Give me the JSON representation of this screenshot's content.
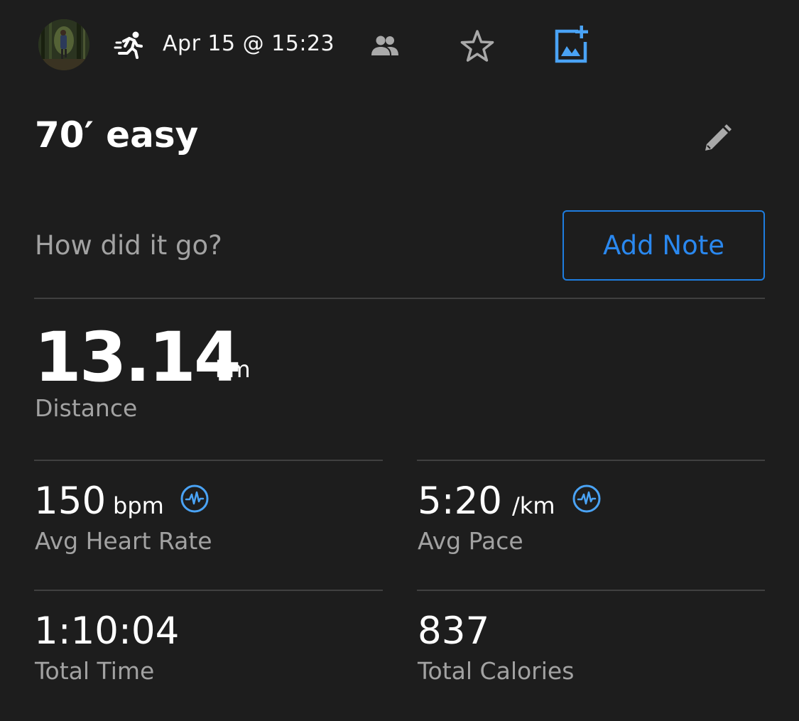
{
  "header": {
    "date_time": "Apr 15 @ 15:23",
    "icons": [
      "avatar",
      "running-icon",
      "people-icon",
      "star-icon",
      "add-photo-icon"
    ]
  },
  "activity": {
    "title": "70′ easy"
  },
  "note": {
    "prompt": "How did it go?",
    "button_label": "Add Note"
  },
  "stats": {
    "distance": {
      "value": "13.14",
      "unit": "km",
      "label": "Distance"
    },
    "heart_rate": {
      "value": "150",
      "unit": "bpm",
      "label": "Avg Heart Rate"
    },
    "pace": {
      "value": "5:20",
      "unit": "/km",
      "label": "Avg Pace"
    },
    "total_time": {
      "value": "1:10:04",
      "label": "Total Time"
    },
    "calories": {
      "value": "837",
      "label": "Total Calories"
    }
  },
  "colors": {
    "background": "#1d1d1d",
    "accent": "#2a88ef",
    "icon_blue": "#4aa3f5",
    "secondary_text": "#a2a2a2",
    "divider": "#404040"
  }
}
